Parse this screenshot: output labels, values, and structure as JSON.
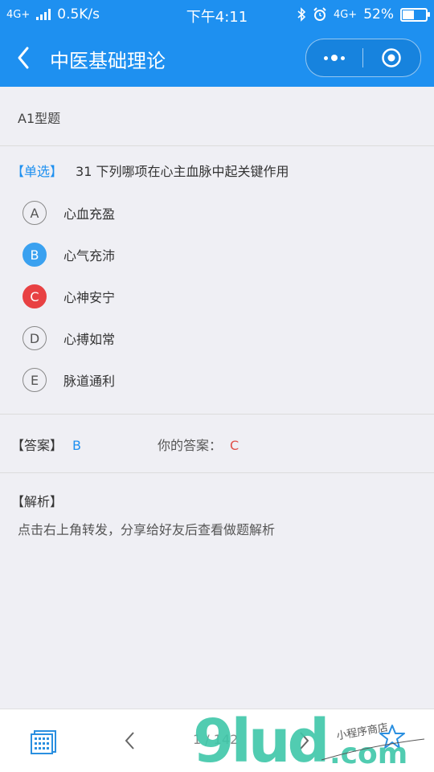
{
  "status_bar": {
    "network_left": "4G+",
    "speed": "0.5K/s",
    "time": "下午4:11",
    "network_right": "4G+",
    "battery": "52%",
    "battery_level": 0.52
  },
  "nav": {
    "title": "中医基础理论"
  },
  "section": {
    "title": "A1型题"
  },
  "question": {
    "type_tag": "【单选】",
    "text": "31 下列哪项在心主血脉中起关键作用",
    "options": [
      {
        "letter": "A",
        "text": "心血充盈",
        "state": "normal"
      },
      {
        "letter": "B",
        "text": "心气充沛",
        "state": "correct"
      },
      {
        "letter": "C",
        "text": "心神安宁",
        "state": "wrong"
      },
      {
        "letter": "D",
        "text": "心搏如常",
        "state": "normal"
      },
      {
        "letter": "E",
        "text": "脉道通利",
        "state": "normal"
      }
    ]
  },
  "answer": {
    "label": "【答案】",
    "value": "B",
    "yours_label": "你的答案：",
    "yours_value": "C"
  },
  "analysis": {
    "title": "【解析】",
    "text": "点击右上角转发，分享给好友后查看做题解析"
  },
  "bottom_bar": {
    "page": "1 / 142"
  },
  "watermark": {
    "text": "9lud.com",
    "tagline": "小程序商店"
  },
  "colors": {
    "primary": "#1e90f0",
    "correct": "#3aa1f0",
    "wrong": "#e84143",
    "watermark_green": "#3ec6a8"
  }
}
